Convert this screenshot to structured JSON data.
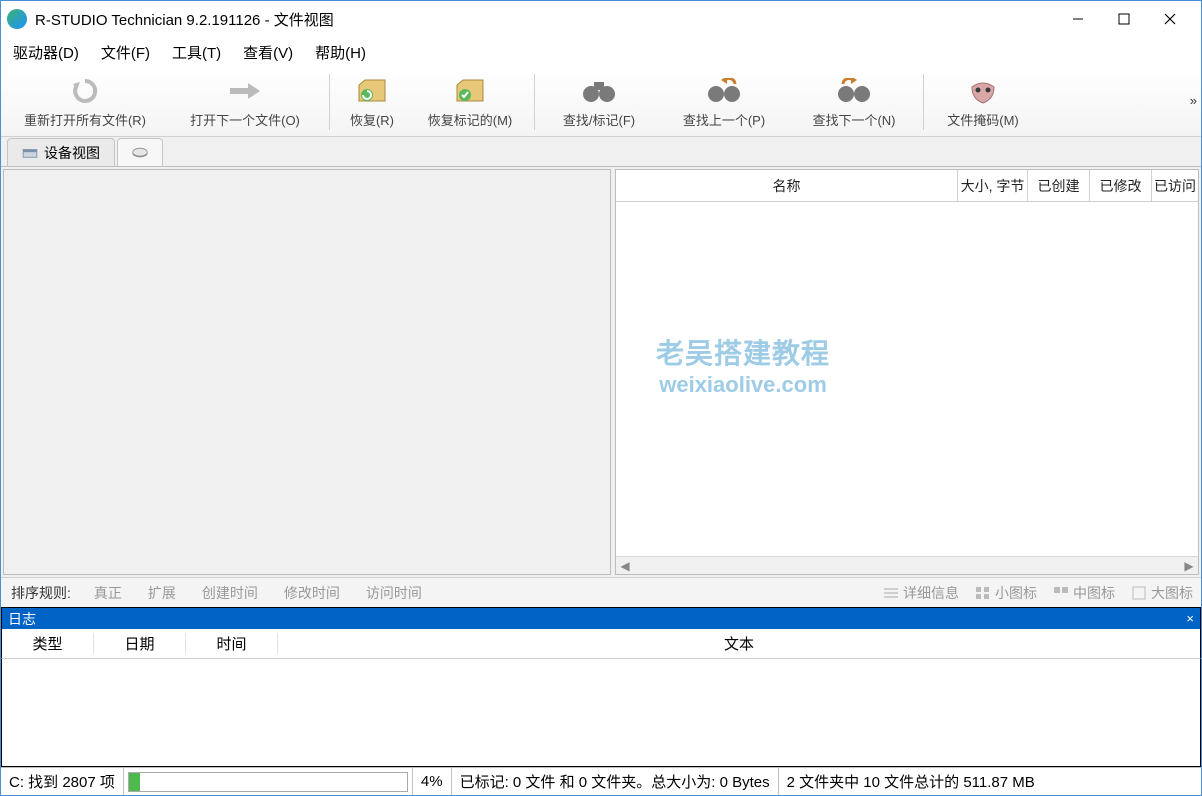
{
  "window": {
    "title": "R-STUDIO Technician 9.2.191126 - 文件视图"
  },
  "menu": {
    "drives": "驱动器(D)",
    "file": "文件(F)",
    "tools": "工具(T)",
    "view": "查看(V)",
    "help": "帮助(H)"
  },
  "toolbar": {
    "reopen": "重新打开所有文件(R)",
    "opennext": "打开下一个文件(O)",
    "recover": "恢复(R)",
    "recover_marked": "恢复标记的(M)",
    "find_mark": "查找/标记(F)",
    "find_prev": "查找上一个(P)",
    "find_next": "查找下一个(N)",
    "file_mask": "文件掩码(M)",
    "more": "»"
  },
  "tabs": {
    "device_view": "设备视图"
  },
  "columns": {
    "name": "名称",
    "size": "大小, 字节",
    "created": "已创建",
    "modified": "已修改",
    "accessed": "已访问"
  },
  "watermark": {
    "line1": "老吴搭建教程",
    "line2": "weixiaolive.com"
  },
  "sort": {
    "label": "排序规则:",
    "real": "真正",
    "ext": "扩展",
    "ctime": "创建时间",
    "mtime": "修改时间",
    "atime": "访问时间"
  },
  "views": {
    "detail": "详细信息",
    "small": "小图标",
    "medium": "中图标",
    "large": "大图标"
  },
  "log": {
    "title": "日志",
    "col_type": "类型",
    "col_date": "日期",
    "col_time": "时间",
    "col_text": "文本"
  },
  "status": {
    "scan": "C: 找到 2807 项",
    "percent": "4%",
    "marked": "已标记: 0 文件 和 0 文件夹。总大小为: 0 Bytes",
    "totals": "2 文件夹中 10 文件总计的 511.87 MB"
  }
}
